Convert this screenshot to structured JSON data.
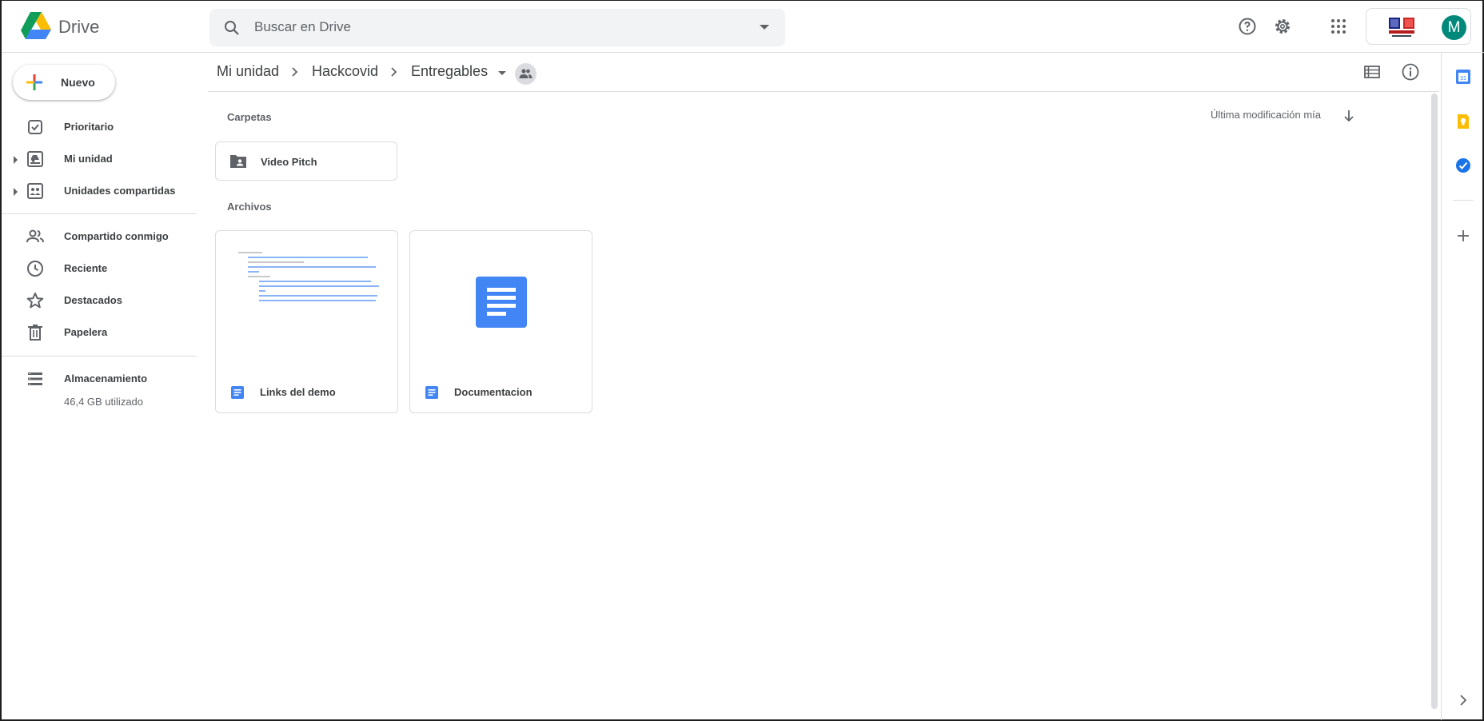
{
  "header": {
    "brand": "Drive",
    "search_placeholder": "Buscar en Drive",
    "avatar_letter": "M"
  },
  "sidebar": {
    "new_label": "Nuevo",
    "items": [
      {
        "label": "Prioritario"
      },
      {
        "label": "Mi unidad"
      },
      {
        "label": "Unidades compartidas"
      },
      {
        "label": "Compartido conmigo"
      },
      {
        "label": "Reciente"
      },
      {
        "label": "Destacados"
      },
      {
        "label": "Papelera"
      },
      {
        "label": "Almacenamiento"
      }
    ],
    "storage_used": "46,4 GB utilizado"
  },
  "breadcrumb": [
    "Mi unidad",
    "Hackcovid",
    "Entregables"
  ],
  "content": {
    "folders_title": "Carpetas",
    "sort_label": "Última modificación mía",
    "files_title": "Archivos",
    "folders": [
      {
        "name": "Video Pitch"
      }
    ],
    "files": [
      {
        "name": "Links del demo"
      },
      {
        "name": "Documentacion"
      }
    ]
  },
  "colors": {
    "docs_blue": "#4285f4",
    "avatar": "#00897b",
    "keep_yellow": "#fbbc04"
  }
}
